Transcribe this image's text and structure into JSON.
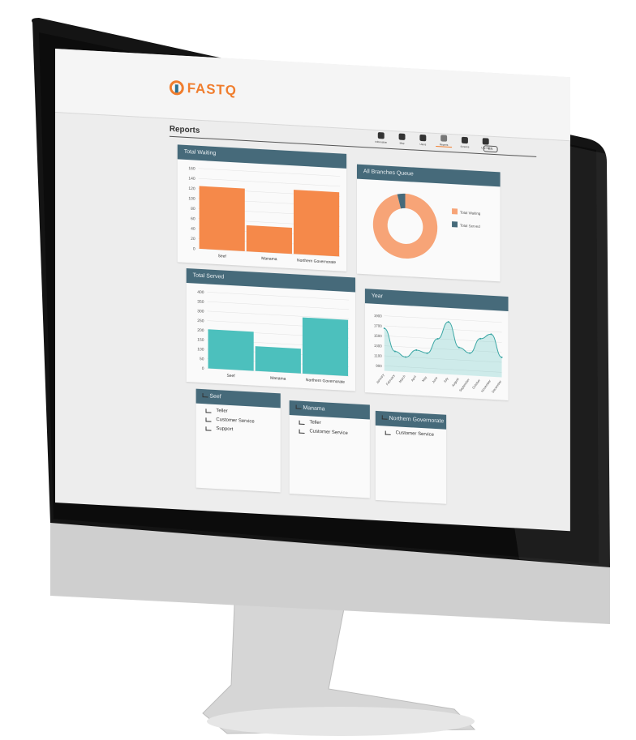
{
  "app": {
    "brand": "FASTQ",
    "page_title": "Reports",
    "language": "EN"
  },
  "nav": [
    {
      "label": "Information",
      "icon": "person-icon"
    },
    {
      "label": "Map",
      "icon": "map-icon"
    },
    {
      "label": "Users",
      "icon": "users-icon"
    },
    {
      "label": "Reports",
      "icon": "chart-icon",
      "active": true
    },
    {
      "label": "Screens",
      "icon": "monitor-icon"
    },
    {
      "label": "Log Out",
      "icon": "power-icon"
    }
  ],
  "panels": {
    "total_waiting": "Total Waiting",
    "all_branches_queue": "All Branches Queue",
    "total_served": "Total Served",
    "year": "Year",
    "seef": "Seef",
    "manama": "Manama",
    "northern": "Northern Governorate"
  },
  "branch_services": {
    "seef": [
      "Teller",
      "Customer Service",
      "Support"
    ],
    "manama": [
      "Teller",
      "Customer Service"
    ],
    "northern": [
      "Customer Service"
    ]
  },
  "colors": {
    "orange": "#f5894a",
    "teal": "#4cc0bd",
    "header": "#466a7a",
    "donut_light": "#f7a477",
    "donut_dark": "#466a7a"
  },
  "chart_data": [
    {
      "type": "bar",
      "title": "Total Waiting",
      "categories": [
        "Seef",
        "Manama",
        "Northern Governorate"
      ],
      "values": [
        125,
        52,
        128
      ],
      "ylim": [
        0,
        160
      ],
      "yticks": [
        0,
        20,
        40,
        60,
        80,
        100,
        120,
        140,
        160
      ]
    },
    {
      "type": "pie",
      "title": "All Branches Queue",
      "labels": [
        "Total Waiting",
        "Total Served"
      ],
      "values": [
        96,
        4
      ]
    },
    {
      "type": "bar",
      "title": "Total Served",
      "categories": [
        "Seef",
        "Manama",
        "Northern Governorate"
      ],
      "values": [
        205,
        130,
        295
      ],
      "ylim": [
        0,
        400
      ],
      "yticks": [
        0,
        50,
        100,
        150,
        200,
        250,
        300,
        350,
        400
      ]
    },
    {
      "type": "area",
      "title": "Year",
      "categories": [
        "January",
        "February",
        "March",
        "April",
        "May",
        "June",
        "July",
        "August",
        "September",
        "October",
        "November",
        "December"
      ],
      "values": [
        1650,
        1200,
        1100,
        1250,
        1200,
        1500,
        1850,
        1350,
        1250,
        1550,
        1650,
        1200
      ],
      "ylim": [
        800,
        2000
      ],
      "yticks": [
        900,
        1100,
        1300,
        1500,
        1700,
        1900
      ]
    }
  ]
}
